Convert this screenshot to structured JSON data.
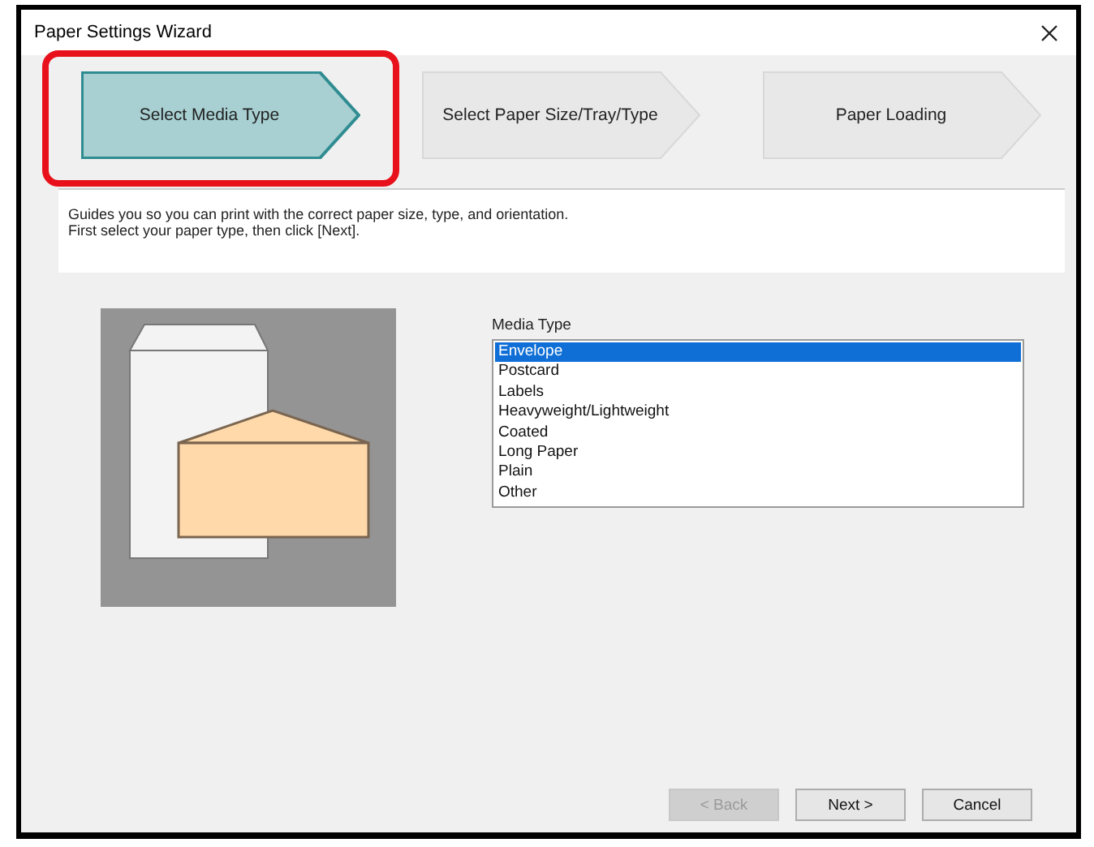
{
  "window": {
    "title": "Paper Settings Wizard"
  },
  "steps": [
    {
      "label": "Select Media Type",
      "selected": true,
      "highlighted": true
    },
    {
      "label": "Select Paper Size/Tray/Type",
      "selected": false,
      "highlighted": false
    },
    {
      "label": "Paper Loading",
      "selected": false,
      "highlighted": false
    }
  ],
  "description": [
    "Guides you so you can print with the correct paper size, type, and orientation.",
    "First select your paper type, then click [Next]."
  ],
  "media_type": {
    "label": "Media Type",
    "items": [
      {
        "label": "Envelope",
        "selected": true
      },
      {
        "label": "Postcard",
        "selected": false
      },
      {
        "label": "Labels",
        "selected": false
      },
      {
        "label": "Heavyweight/Lightweight",
        "selected": false
      },
      {
        "label": "Coated",
        "selected": false
      },
      {
        "label": "Long Paper",
        "selected": false
      },
      {
        "label": "Plain",
        "selected": false
      },
      {
        "label": "Other",
        "selected": false
      }
    ]
  },
  "buttons": [
    {
      "label": "< Back",
      "disabled": true
    },
    {
      "label": "Next >",
      "disabled": false
    },
    {
      "label": "Cancel",
      "disabled": false
    }
  ]
}
